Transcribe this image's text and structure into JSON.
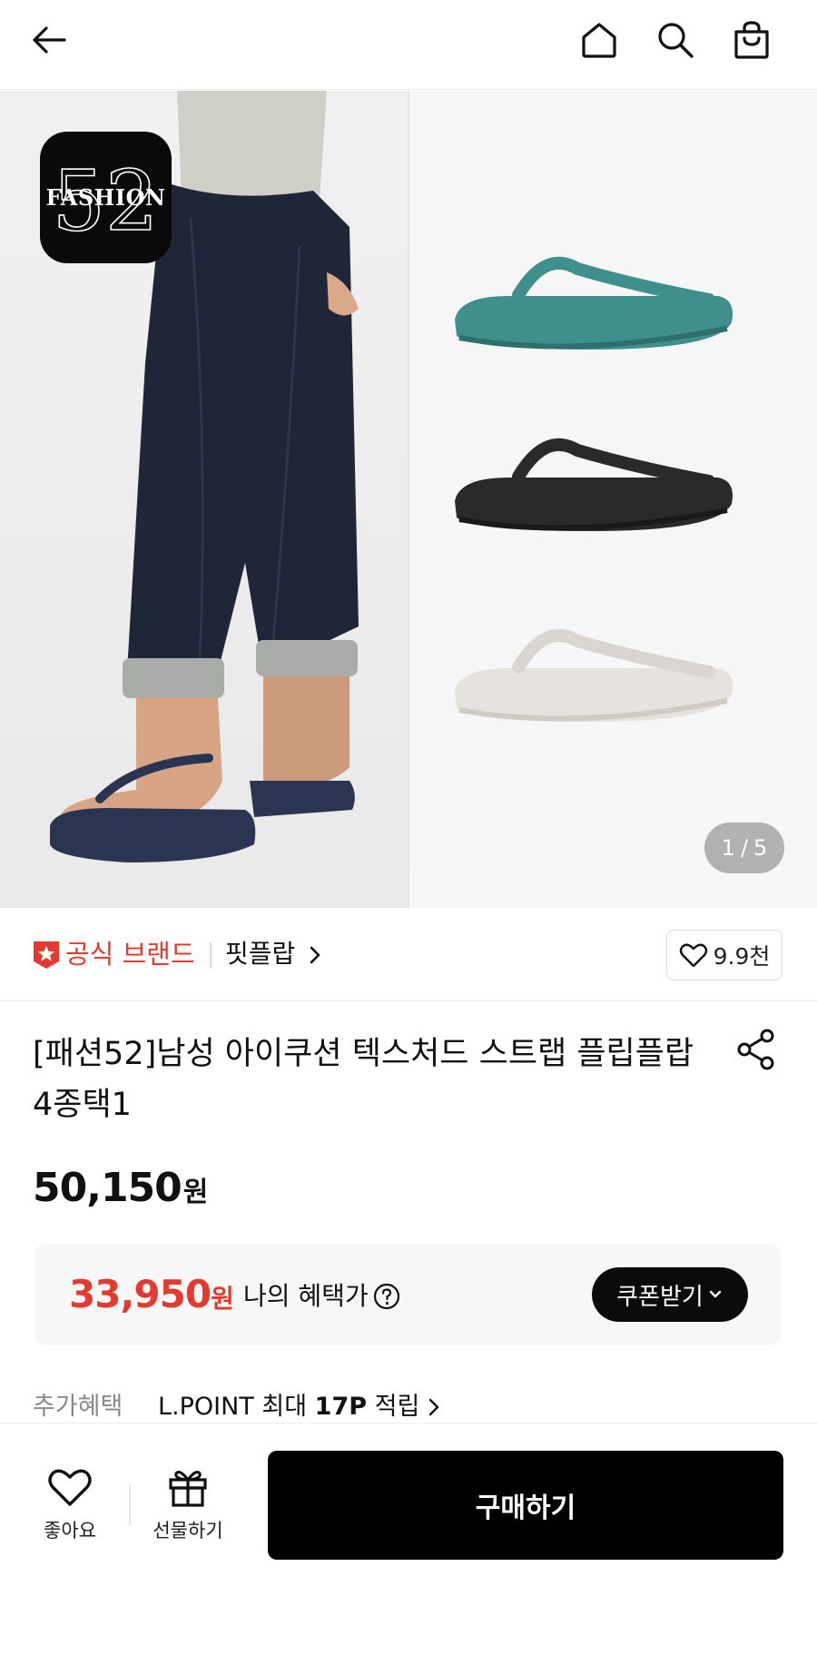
{
  "header": {
    "back_icon": "arrow-left-icon",
    "home_icon": "home-icon",
    "search_icon": "search-icon",
    "cart_icon": "shopping-bag-icon"
  },
  "hero": {
    "logo_text": "FASHION",
    "logo_number": "52",
    "page_current": "1",
    "page_separator": "/",
    "page_total": "5",
    "product_colors": [
      "#3f8f8d",
      "#2a2a2a",
      "#e6e3df"
    ],
    "model_sandal_color": "#2b3552"
  },
  "brand": {
    "official_label": "공식 브랜드",
    "name": "핏플랍",
    "like_count": "9.9천",
    "accent_color": "#e53a30"
  },
  "product": {
    "title": "[패션52]남성 아이쿠션 텍스처드 스트랩 플립플랍 4종택1",
    "price": "50,150",
    "price_unit": "원"
  },
  "benefit": {
    "price": "33,950",
    "price_unit": "원",
    "label": "나의 혜택가",
    "coupon_label": "쿠폰받기"
  },
  "extra": {
    "label": "추가혜택",
    "value_prefix": "L.POINT 최대 ",
    "value_bold": "17P",
    "value_suffix": " 적립"
  },
  "bottom": {
    "like_label": "좋아요",
    "gift_label": "선물하기",
    "buy_label": "구매하기"
  }
}
